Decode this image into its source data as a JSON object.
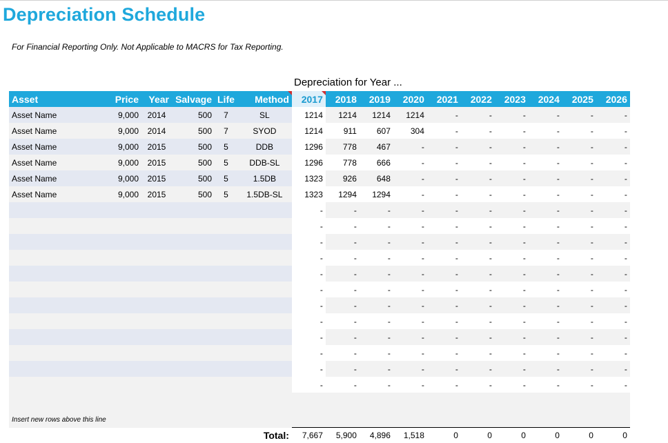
{
  "title": "Depreciation Schedule",
  "subtitle": "For Financial Reporting Only. Not Applicable to MACRS for Tax Reporting.",
  "dep_label": "Depreciation for Year ...",
  "headers": {
    "asset": "Asset",
    "price": "Price",
    "year": "Year",
    "salvage": "Salvage",
    "life": "Life",
    "method": "Method",
    "years": [
      "2017",
      "2018",
      "2019",
      "2020",
      "2021",
      "2022",
      "2023",
      "2024",
      "2025",
      "2026"
    ]
  },
  "rows": [
    {
      "asset": "Asset Name",
      "price": "9,000",
      "year": "2014",
      "salvage": "500",
      "life": "7",
      "method": "SL",
      "dep": [
        "1214",
        "1214",
        "1214",
        "1214",
        "-",
        "-",
        "-",
        "-",
        "-",
        "-"
      ]
    },
    {
      "asset": "Asset Name",
      "price": "9,000",
      "year": "2014",
      "salvage": "500",
      "life": "7",
      "method": "SYOD",
      "dep": [
        "1214",
        "911",
        "607",
        "304",
        "-",
        "-",
        "-",
        "-",
        "-",
        "-"
      ]
    },
    {
      "asset": "Asset Name",
      "price": "9,000",
      "year": "2015",
      "salvage": "500",
      "life": "5",
      "method": "DDB",
      "dep": [
        "1296",
        "778",
        "467",
        "-",
        "-",
        "-",
        "-",
        "-",
        "-",
        "-"
      ]
    },
    {
      "asset": "Asset Name",
      "price": "9,000",
      "year": "2015",
      "salvage": "500",
      "life": "5",
      "method": "DDB-SL",
      "dep": [
        "1296",
        "778",
        "666",
        "-",
        "-",
        "-",
        "-",
        "-",
        "-",
        "-"
      ]
    },
    {
      "asset": "Asset Name",
      "price": "9,000",
      "year": "2015",
      "salvage": "500",
      "life": "5",
      "method": "1.5DB",
      "dep": [
        "1323",
        "926",
        "648",
        "-",
        "-",
        "-",
        "-",
        "-",
        "-",
        "-"
      ]
    },
    {
      "asset": "Asset Name",
      "price": "9,000",
      "year": "2015",
      "salvage": "500",
      "life": "5",
      "method": "1.5DB-SL",
      "dep": [
        "1323",
        "1294",
        "1294",
        "-",
        "-",
        "-",
        "-",
        "-",
        "-",
        "-"
      ]
    },
    {
      "asset": "",
      "price": "",
      "year": "",
      "salvage": "",
      "life": "",
      "method": "",
      "dep": [
        "-",
        "-",
        "-",
        "-",
        "-",
        "-",
        "-",
        "-",
        "-",
        "-"
      ]
    },
    {
      "asset": "",
      "price": "",
      "year": "",
      "salvage": "",
      "life": "",
      "method": "",
      "dep": [
        "-",
        "-",
        "-",
        "-",
        "-",
        "-",
        "-",
        "-",
        "-",
        "-"
      ]
    },
    {
      "asset": "",
      "price": "",
      "year": "",
      "salvage": "",
      "life": "",
      "method": "",
      "dep": [
        "-",
        "-",
        "-",
        "-",
        "-",
        "-",
        "-",
        "-",
        "-",
        "-"
      ]
    },
    {
      "asset": "",
      "price": "",
      "year": "",
      "salvage": "",
      "life": "",
      "method": "",
      "dep": [
        "-",
        "-",
        "-",
        "-",
        "-",
        "-",
        "-",
        "-",
        "-",
        "-"
      ]
    },
    {
      "asset": "",
      "price": "",
      "year": "",
      "salvage": "",
      "life": "",
      "method": "",
      "dep": [
        "-",
        "-",
        "-",
        "-",
        "-",
        "-",
        "-",
        "-",
        "-",
        "-"
      ]
    },
    {
      "asset": "",
      "price": "",
      "year": "",
      "salvage": "",
      "life": "",
      "method": "",
      "dep": [
        "-",
        "-",
        "-",
        "-",
        "-",
        "-",
        "-",
        "-",
        "-",
        "-"
      ]
    },
    {
      "asset": "",
      "price": "",
      "year": "",
      "salvage": "",
      "life": "",
      "method": "",
      "dep": [
        "-",
        "-",
        "-",
        "-",
        "-",
        "-",
        "-",
        "-",
        "-",
        "-"
      ]
    },
    {
      "asset": "",
      "price": "",
      "year": "",
      "salvage": "",
      "life": "",
      "method": "",
      "dep": [
        "-",
        "-",
        "-",
        "-",
        "-",
        "-",
        "-",
        "-",
        "-",
        "-"
      ]
    },
    {
      "asset": "",
      "price": "",
      "year": "",
      "salvage": "",
      "life": "",
      "method": "",
      "dep": [
        "-",
        "-",
        "-",
        "-",
        "-",
        "-",
        "-",
        "-",
        "-",
        "-"
      ]
    },
    {
      "asset": "",
      "price": "",
      "year": "",
      "salvage": "",
      "life": "",
      "method": "",
      "dep": [
        "-",
        "-",
        "-",
        "-",
        "-",
        "-",
        "-",
        "-",
        "-",
        "-"
      ]
    },
    {
      "asset": "",
      "price": "",
      "year": "",
      "salvage": "",
      "life": "",
      "method": "",
      "dep": [
        "-",
        "-",
        "-",
        "-",
        "-",
        "-",
        "-",
        "-",
        "-",
        "-"
      ]
    },
    {
      "asset": "",
      "price": "",
      "year": "",
      "salvage": "",
      "life": "",
      "method": "",
      "dep": [
        "-",
        "-",
        "-",
        "-",
        "-",
        "-",
        "-",
        "-",
        "-",
        "-"
      ]
    }
  ],
  "insert_note": "Insert new rows above this line",
  "total_label": "Total:",
  "totals": [
    "7,667",
    "5,900",
    "4,896",
    "1,518",
    "0",
    "0",
    "0",
    "0",
    "0",
    "0"
  ],
  "colors": {
    "accent": "#1fa8dc",
    "row_band_left": "#e4e8f2",
    "row_band": "#f2f2f2"
  }
}
